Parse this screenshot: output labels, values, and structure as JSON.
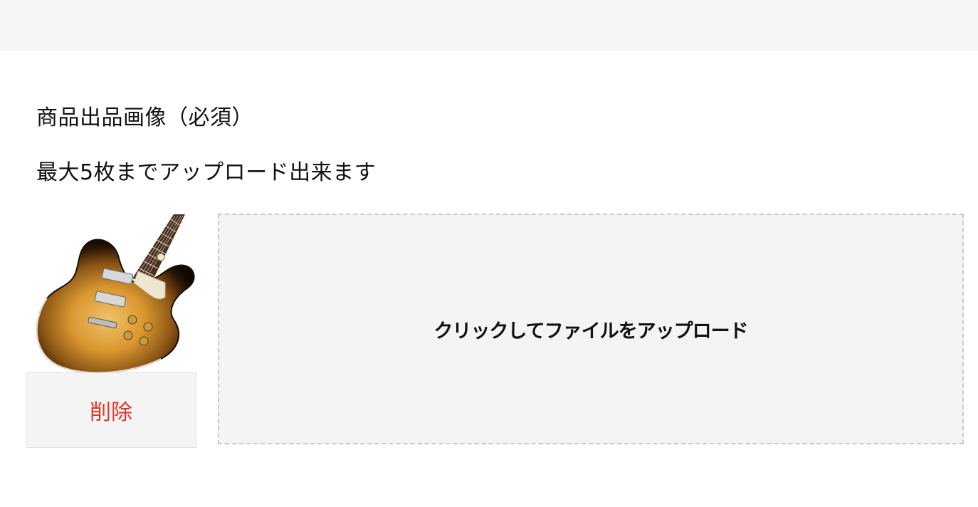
{
  "header": {
    "background": "#f6f6f6"
  },
  "images_section": {
    "title": "商品出品画像（必須）",
    "note": "最大5枚までアップロード出来ます",
    "items": [
      {
        "thumbnail_icon": "guitar-photo",
        "delete_label": "削除",
        "delete_color": "#e0392b"
      }
    ],
    "upload_label": "クリックしてファイルをアップロード"
  }
}
